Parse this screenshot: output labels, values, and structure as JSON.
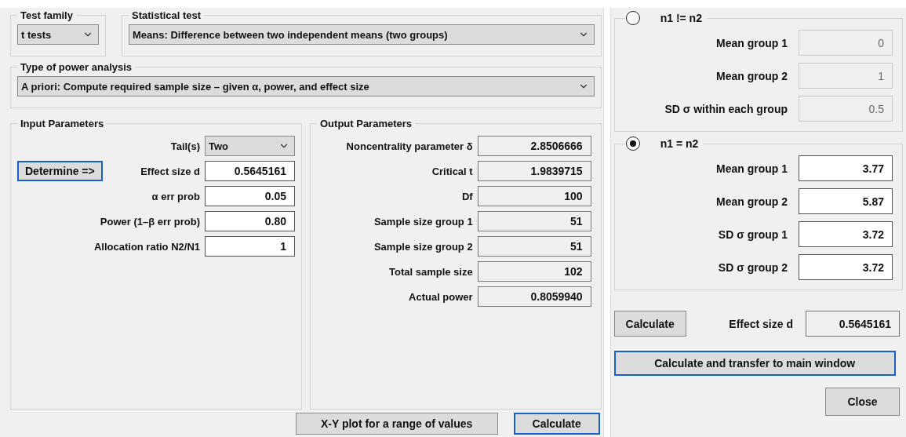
{
  "main": {
    "test_family": {
      "label": "Test family",
      "value": "t tests"
    },
    "statistical_test": {
      "label": "Statistical test",
      "value": "Means: Difference between two independent means (two groups)"
    },
    "power_analysis_type": {
      "label": "Type of power analysis",
      "value": "A priori: Compute required sample size – given α, power, and effect size"
    },
    "input_parameters": {
      "title": "Input Parameters",
      "rows": [
        {
          "kind": "select",
          "label": "Tail(s)",
          "value": "Two"
        },
        {
          "kind": "field",
          "label": "Effect size d",
          "value": "0.5645161",
          "button": "Determine =>"
        },
        {
          "kind": "field",
          "label": "α err prob",
          "value": "0.05"
        },
        {
          "kind": "field",
          "label": "Power (1–β err prob)",
          "value": "0.80"
        },
        {
          "kind": "field",
          "label": "Allocation ratio N2/N1",
          "value": "1"
        }
      ]
    },
    "output_parameters": {
      "title": "Output Parameters",
      "rows": [
        {
          "label": "Noncentrality parameter δ",
          "value": "2.8506666"
        },
        {
          "label": "Critical t",
          "value": "1.9839715"
        },
        {
          "label": "Df",
          "value": "100"
        },
        {
          "label": "Sample size group 1",
          "value": "51"
        },
        {
          "label": "Sample size group 2",
          "value": "51"
        },
        {
          "label": "Total sample size",
          "value": "102"
        },
        {
          "label": "Actual power",
          "value": "0.8059940"
        }
      ]
    },
    "buttons": [
      {
        "label": "X-Y plot for a range of values",
        "focused": false
      },
      {
        "label": "Calculate",
        "focused": true
      }
    ]
  },
  "effect_size_dialog": {
    "groups": [
      {
        "label": "n1 != n2",
        "selected": false,
        "rows": [
          {
            "label": "Mean group 1",
            "value": "0"
          },
          {
            "label": "Mean group 2",
            "value": "1"
          },
          {
            "label": "SD σ within each group",
            "value": "0.5"
          }
        ]
      },
      {
        "label": "n1 = n2",
        "selected": true,
        "rows": [
          {
            "label": "Mean group 1",
            "value": "3.77"
          },
          {
            "label": "Mean group 2",
            "value": "5.87"
          },
          {
            "label": "SD σ group 1",
            "value": "3.72"
          },
          {
            "label": "SD σ group 2",
            "value": "3.72"
          }
        ]
      }
    ],
    "calculate_button": "Calculate",
    "effect_size": {
      "label": "Effect size d",
      "value": "0.5645161"
    },
    "transfer_button": "Calculate and transfer to main window",
    "close_button": "Close"
  }
}
